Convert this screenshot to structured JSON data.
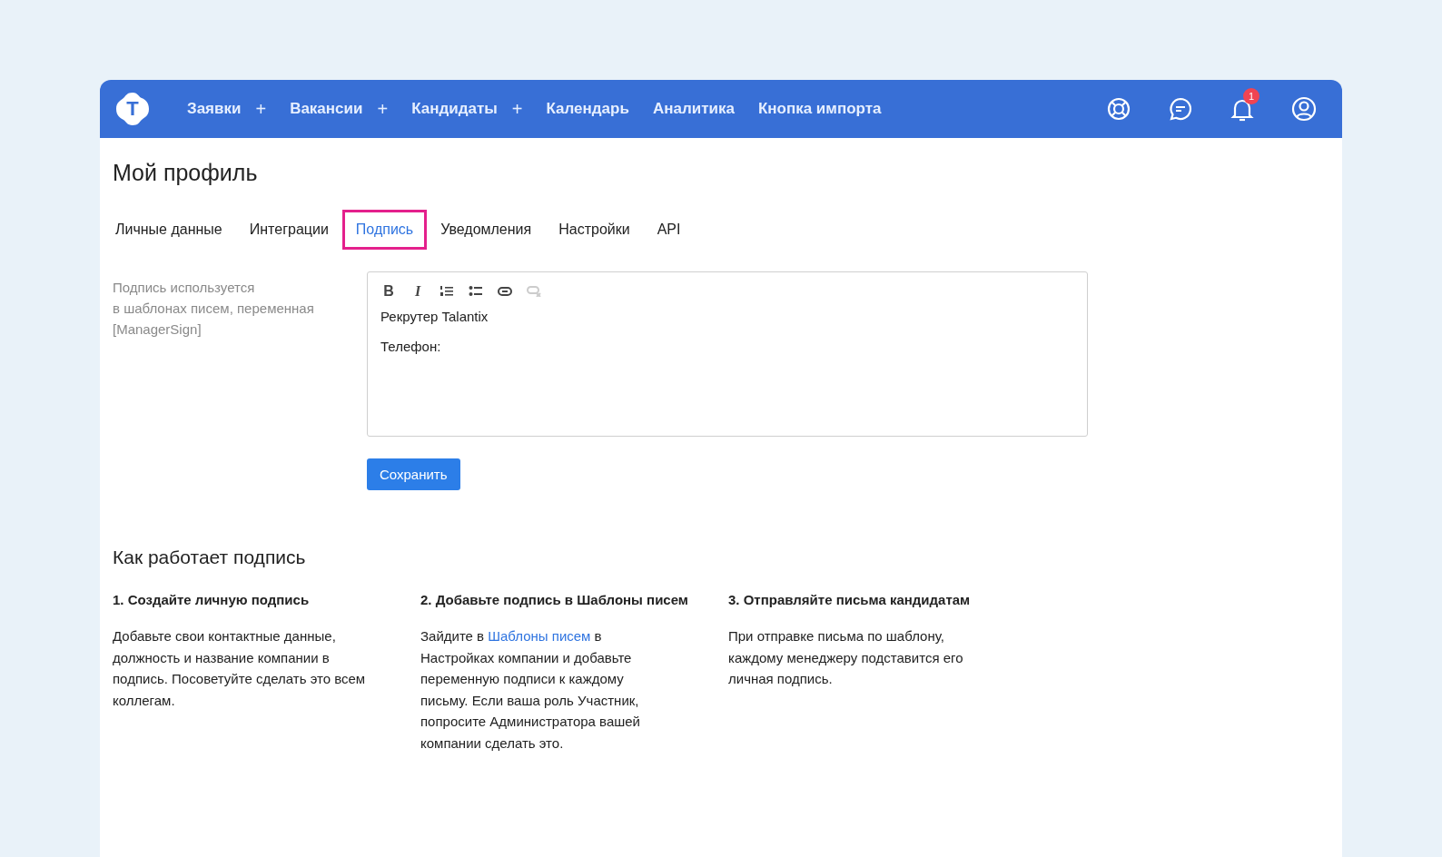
{
  "nav": {
    "items": [
      {
        "label": "Заявки",
        "add": "+"
      },
      {
        "label": "Вакансии",
        "add": "+"
      },
      {
        "label": "Кандидаты",
        "add": "+"
      },
      {
        "label": "Календарь"
      },
      {
        "label": "Аналитика"
      },
      {
        "label": "Кнопка импорта"
      }
    ],
    "logo": "T",
    "actions": [
      {
        "kind": "support"
      },
      {
        "kind": "chat"
      },
      {
        "kind": "bell",
        "badge": "1"
      },
      {
        "kind": "user"
      }
    ]
  },
  "page": {
    "title": "Мой профиль"
  },
  "tabs": [
    {
      "label": "Личные данные",
      "selected": false
    },
    {
      "label": "Интеграции",
      "selected": false
    },
    {
      "label": "Подпись",
      "selected": true
    },
    {
      "label": "Уведомления",
      "selected": false
    },
    {
      "label": "Настройки",
      "selected": false
    },
    {
      "label": "API",
      "selected": false
    }
  ],
  "signature": {
    "hint": [
      "Подпись используется",
      "в шаблонах писем, переменная",
      "[ManagerSign]"
    ],
    "toolbar": [
      {
        "kind": "bold",
        "label": "B",
        "disabled": false
      },
      {
        "kind": "italic",
        "label": "I",
        "disabled": false
      },
      {
        "kind": "ordered-list",
        "disabled": false
      },
      {
        "kind": "bullet-list",
        "disabled": false
      },
      {
        "kind": "link",
        "disabled": false
      },
      {
        "kind": "unlink",
        "disabled": true
      }
    ],
    "lines": [
      "Рекрутер Talantix",
      "Телефон:"
    ],
    "save": "Сохранить"
  },
  "how": {
    "title": "Как работает подпись",
    "steps": [
      {
        "title": "1. Создайте личную подпись",
        "parts": [
          {
            "text": "Добавьте свои контактные данные, должность и название компании в подпись. Посоветуйте сделать это всем коллегам."
          }
        ]
      },
      {
        "title": "2. Добавьте подпись в Шаблоны писем",
        "parts": [
          {
            "text": "Зайдите в "
          },
          {
            "text": "Шаблоны писем",
            "kind": "link"
          },
          {
            "text": " в Настройках компании и добавьте переменную подписи к каждому письму. Если ваша роль Участник, попросите Администратора вашей компании сделать это."
          }
        ]
      },
      {
        "title": "3. Отправляйте письма кандидатам",
        "parts": [
          {
            "text": "При отправке письма по шаблону, каждому менеджеру подставится его личная подпись."
          }
        ]
      }
    ]
  }
}
